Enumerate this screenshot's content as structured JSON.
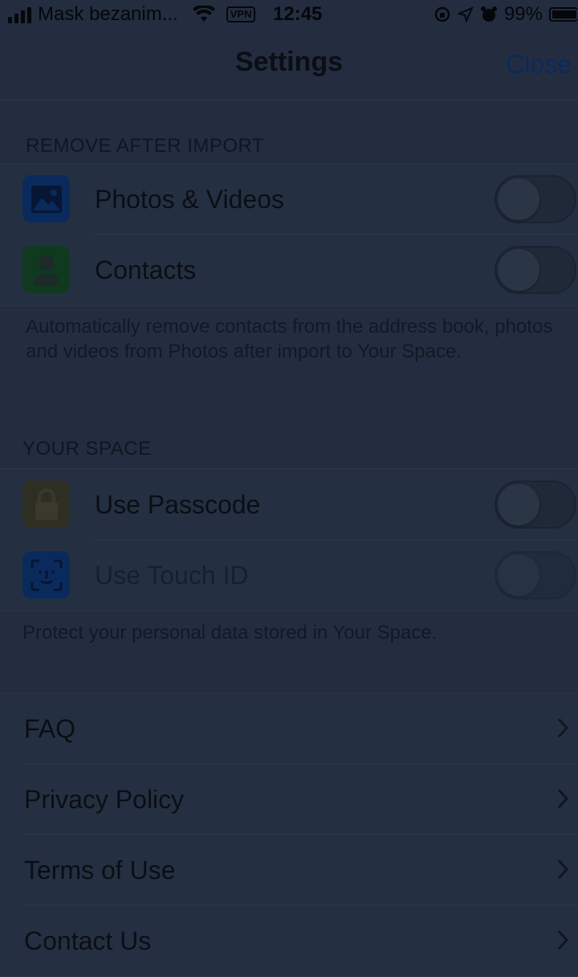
{
  "status_bar": {
    "carrier": "Mask bezanim...",
    "vpn": "VPN",
    "time": "12:45",
    "battery": "99%"
  },
  "nav": {
    "title": "Settings",
    "close": "Close"
  },
  "sections": {
    "remove_after_import": {
      "header": "REMOVE AFTER IMPORT",
      "rows": [
        {
          "label": "Photos & Videos",
          "icon": "photos-icon",
          "icon_color": "#0b2a5c",
          "toggle": "off"
        },
        {
          "label": "Contacts",
          "icon": "contacts-icon",
          "icon_color": "#0f3a1f",
          "toggle": "off"
        }
      ],
      "footer": "Automatically remove contacts from the address book, photos and videos from Photos after import to Your Space."
    },
    "your_space": {
      "header": "YOUR SPACE",
      "rows": [
        {
          "label": "Use Passcode",
          "icon": "lock-icon",
          "icon_color": "#2e2e22",
          "toggle": "off"
        },
        {
          "label": "Use Touch ID",
          "icon": "face-id-icon",
          "icon_color": "#0b2a5c",
          "toggle": "off",
          "disabled": true
        }
      ],
      "footer": "Protect your personal data stored in Your Space."
    },
    "links": {
      "rows": [
        {
          "label": "FAQ"
        },
        {
          "label": "Privacy Policy"
        },
        {
          "label": "Terms of Use"
        },
        {
          "label": "Contact Us"
        }
      ]
    }
  },
  "colors": {
    "background": "#232d3f",
    "accent": "#0b2a5c"
  }
}
